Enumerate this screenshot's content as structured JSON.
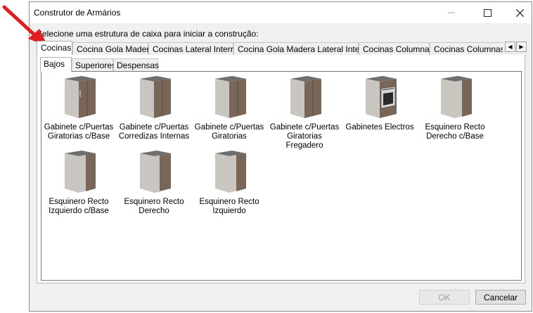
{
  "window": {
    "title": "Construtor de Armários",
    "instruction": "Selecione uma estrutura de caixa para iniciar a construção:"
  },
  "top_tabs": [
    {
      "label": "Cocinas",
      "active": true
    },
    {
      "label": "Cocina Gola Madera",
      "active": false
    },
    {
      "label": "Cocinas Lateral Interna",
      "active": false
    },
    {
      "label": "Cocina Gola Madera Lateral Interna",
      "active": false
    },
    {
      "label": "Cocinas Columnas",
      "active": false
    },
    {
      "label": "Cocinas Columnas La",
      "active": false
    }
  ],
  "sub_tabs": [
    {
      "label": "Bajos",
      "active": true
    },
    {
      "label": "Superiores",
      "active": false
    },
    {
      "label": "Despensas",
      "active": false
    }
  ],
  "items": [
    {
      "line1": "Gabinete c/Puertas",
      "line2": "Giratorias c/Base",
      "icon": "cabinet-icon"
    },
    {
      "line1": "Gabinete c/Puertas",
      "line2": "Corredizas Internas",
      "icon": "cabinet-icon"
    },
    {
      "line1": "Gabinete c/Puertas",
      "line2": "Giratorias",
      "icon": "cabinet-icon"
    },
    {
      "line1": "Gabinete c/Puertas",
      "line2": "Giratorias Fregadero",
      "icon": "cabinet-icon"
    },
    {
      "line1": "Gabinetes Electros",
      "line2": "",
      "icon": "oven-cabinet-icon"
    },
    {
      "line1": "Esquinero Recto",
      "line2": "Derecho c/Base",
      "icon": "corner-cabinet-icon"
    },
    {
      "line1": "Esquinero Recto",
      "line2": "Izquierdo c/Base",
      "icon": "corner-cabinet-icon"
    },
    {
      "line1": "Esquinero Recto",
      "line2": "Derecho",
      "icon": "corner-cabinet-icon"
    },
    {
      "line1": "Esquinero Recto",
      "line2": "Izquierdo",
      "icon": "corner-cabinet-icon"
    }
  ],
  "buttons": {
    "ok": "OK",
    "cancel": "Cancelar"
  },
  "colors": {
    "annotation_arrow": "#e02020",
    "wood": "#7a6656",
    "panel": "#c9c6c1"
  }
}
